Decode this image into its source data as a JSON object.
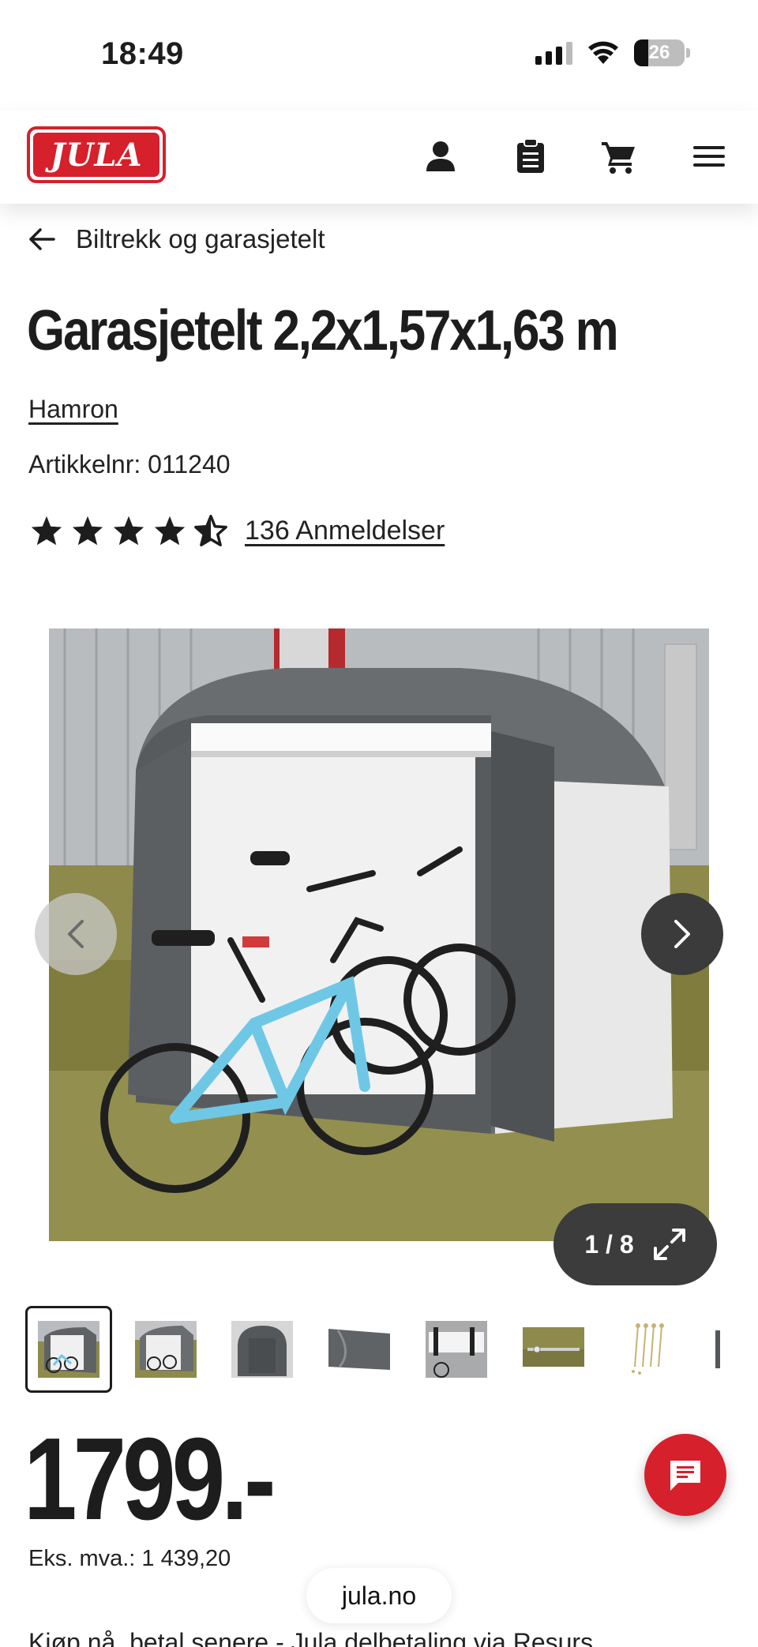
{
  "status_bar": {
    "time": "18:49",
    "battery": "26"
  },
  "header": {
    "logo_text": "JULA"
  },
  "breadcrumb": {
    "label": "Biltrekk og garasjetelt"
  },
  "product": {
    "title": "Garasjetelt 2,2x1,57x1,63 m",
    "brand": "Hamron",
    "article_no": "Artikkelnr: 011240",
    "rating": 4.5,
    "reviews_label": "136 Anmeldelser"
  },
  "gallery": {
    "counter": "1 / 8",
    "thumbnail_count": 8,
    "active_index": 0
  },
  "price": {
    "value": "1799.-",
    "ex_vat": "Eks. mva.: 1 439,20"
  },
  "browser": {
    "url": "jula.no"
  },
  "promo_text": "Kjøp nå, betal senere - Jula delbetaling via Resurs",
  "colors": {
    "brand_red": "#d6202c",
    "text": "#1d1d1d",
    "dark_button": "#3b3b3b"
  }
}
